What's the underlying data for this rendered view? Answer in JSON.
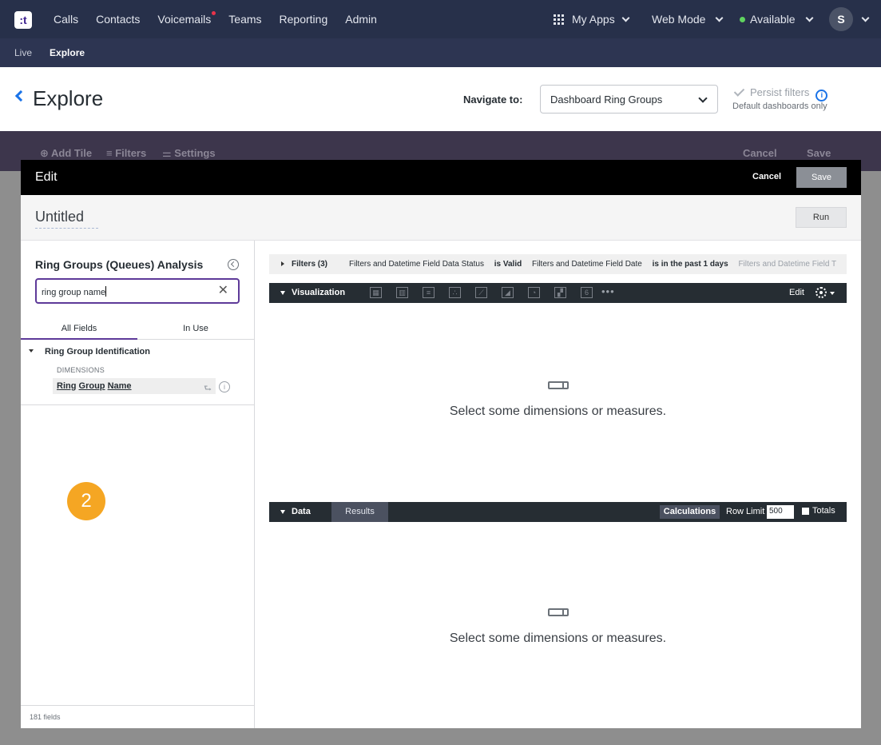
{
  "topnav": {
    "logo": ":t",
    "links": [
      "Calls",
      "Contacts",
      "Voicemails",
      "Teams",
      "Reporting",
      "Admin"
    ],
    "my_apps": "My Apps",
    "web_mode": "Web Mode",
    "status": "Available",
    "avatar": "S"
  },
  "subnav": {
    "items": [
      "Live",
      "Explore"
    ],
    "active": "Explore"
  },
  "header": {
    "title": "Explore",
    "navigate_label": "Navigate to:",
    "navigate_value": "Dashboard Ring Groups",
    "persist_label": "Persist filters",
    "persist_sub": "Default dashboards only"
  },
  "dashbar": {
    "add_tile": "Add Tile",
    "filters": "Filters",
    "settings": "Settings",
    "cancel": "Cancel",
    "save": "Save"
  },
  "modal": {
    "title": "Edit",
    "cancel": "Cancel",
    "save": "Save",
    "query_title": "Untitled",
    "run": "Run"
  },
  "picker": {
    "title": "Ring Groups (Queues) Analysis",
    "search_value": "ring group name",
    "tabs": [
      "All Fields",
      "In Use"
    ],
    "group": "Ring Group Identification",
    "dimensions_label": "DIMENSIONS",
    "field_words": [
      "Ring",
      "Group",
      "Name"
    ],
    "badge": "2",
    "field_count": "181 fields"
  },
  "filters": {
    "label": "Filters (3)",
    "items": [
      {
        "text": "Filters and Datetime Field Data Status",
        "op": "is Valid"
      },
      {
        "text": "Filters and Datetime Field Date",
        "op": "is in the past 1 days"
      },
      {
        "text": "Filters and Datetime Field T",
        "op": ""
      }
    ]
  },
  "visualization": {
    "label": "Visualization",
    "icons": [
      "table-icon",
      "column-chart-icon",
      "bar-chart-icon",
      "scatter-icon",
      "line-icon",
      "area-icon",
      "pie-icon",
      "map-icon",
      "single-value-icon"
    ],
    "single_value_glyph": "6",
    "more": "•••",
    "edit": "Edit",
    "empty_message": "Select some dimensions or measures."
  },
  "data": {
    "label": "Data",
    "results": "Results",
    "calculations": "Calculations",
    "row_limit_label": "Row Limit",
    "row_limit_value": "500",
    "totals_label": "Totals",
    "empty_message": "Select some dimensions or measures."
  }
}
